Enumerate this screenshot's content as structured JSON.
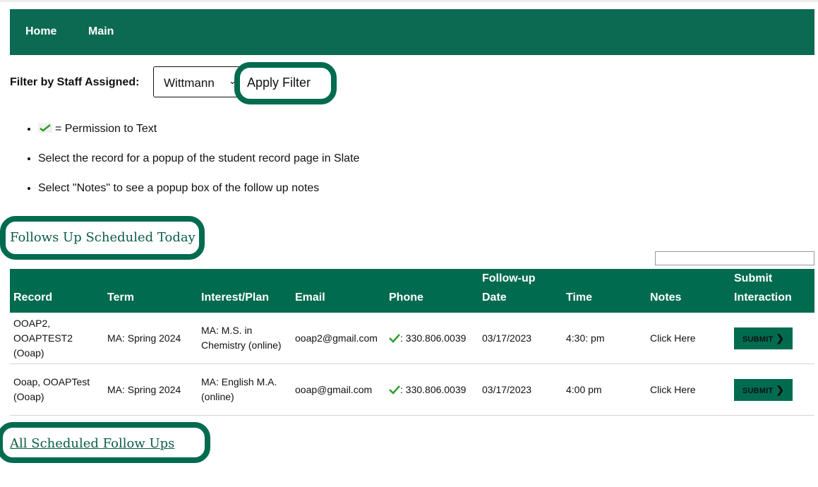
{
  "nav": {
    "items": [
      {
        "label": "Home"
      },
      {
        "label": "Main"
      }
    ]
  },
  "filter": {
    "label": "Filter by Staff Assigned:",
    "selected_staff": "Wittmann",
    "apply_label": "Apply Filter"
  },
  "info": {
    "permission_text": "= Permission to Text",
    "items": [
      "Select the record for a popup of the student record page in Slate",
      "Select \"Notes\" to see a popup box of the follow up notes"
    ]
  },
  "today_section": {
    "title": "Follows Up Scheduled Today"
  },
  "table": {
    "search_value": "",
    "headers": {
      "record": "Record",
      "term": "Term",
      "interest": "Interest/Plan",
      "email": "Email",
      "phone": "Phone",
      "date_line1": "Follow-up",
      "date_line2": "Date",
      "time": "Time",
      "notes": "Notes",
      "submit_line1": "Submit",
      "submit_line2": "Interaction"
    },
    "rows": [
      {
        "record_line1": "OOAP2,",
        "record_line2": "OOAPTEST2",
        "record_line3": "(Ooap)",
        "term": "MA: Spring 2024",
        "interest_line1": "MA: M.S. in",
        "interest_line2": "Chemistry (online)",
        "email": "ooap2@gmail.com",
        "phone": ": 330.806.0039",
        "date": "03/17/2023",
        "time": "4:30: pm",
        "notes": "Click Here",
        "submit": "SUBMIT"
      },
      {
        "record_line1": "Ooap, OOAPTest",
        "record_line2": "(Ooap)",
        "term": "MA: Spring 2024",
        "interest_line1": "MA: English M.A.",
        "interest_line2": "(online)",
        "email": "ooap@gmail.com",
        "phone": ": 330.806.0039",
        "date": "03/17/2023",
        "time": "4:00 pm",
        "notes": "Click Here",
        "submit": "SUBMIT"
      }
    ]
  },
  "all_section": {
    "title": "All Scheduled Follow Ups"
  },
  "colors": {
    "brand_green": "#006b4f",
    "check_green": "#2e9e2e"
  }
}
